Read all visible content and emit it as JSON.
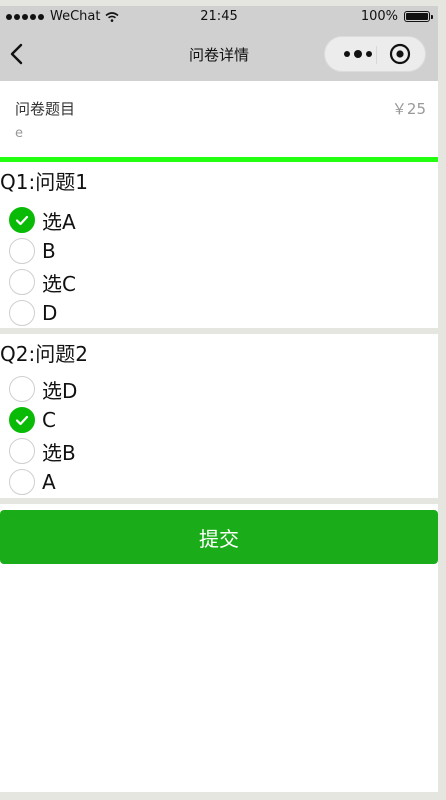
{
  "status_bar": {
    "carrier": "WeChat",
    "time": "21:45",
    "battery": "100%"
  },
  "nav": {
    "title": "问卷详情"
  },
  "survey": {
    "title": "问卷题目",
    "price": "￥25",
    "description": "e"
  },
  "questions": [
    {
      "title": "Q1:问题1",
      "options": [
        {
          "label": "选A",
          "checked": true
        },
        {
          "label": "B",
          "checked": false
        },
        {
          "label": "选C",
          "checked": false
        },
        {
          "label": "D",
          "checked": false
        }
      ]
    },
    {
      "title": "Q2:问题2",
      "options": [
        {
          "label": "选D",
          "checked": false
        },
        {
          "label": "C",
          "checked": true
        },
        {
          "label": "选B",
          "checked": false
        },
        {
          "label": "A",
          "checked": false
        }
      ]
    }
  ],
  "submit_label": "提交",
  "colors": {
    "accent": "#1aad19",
    "radio_checked": "#09bb07",
    "progress_bar": "#22ff11",
    "chrome": "#d0d0d0"
  }
}
